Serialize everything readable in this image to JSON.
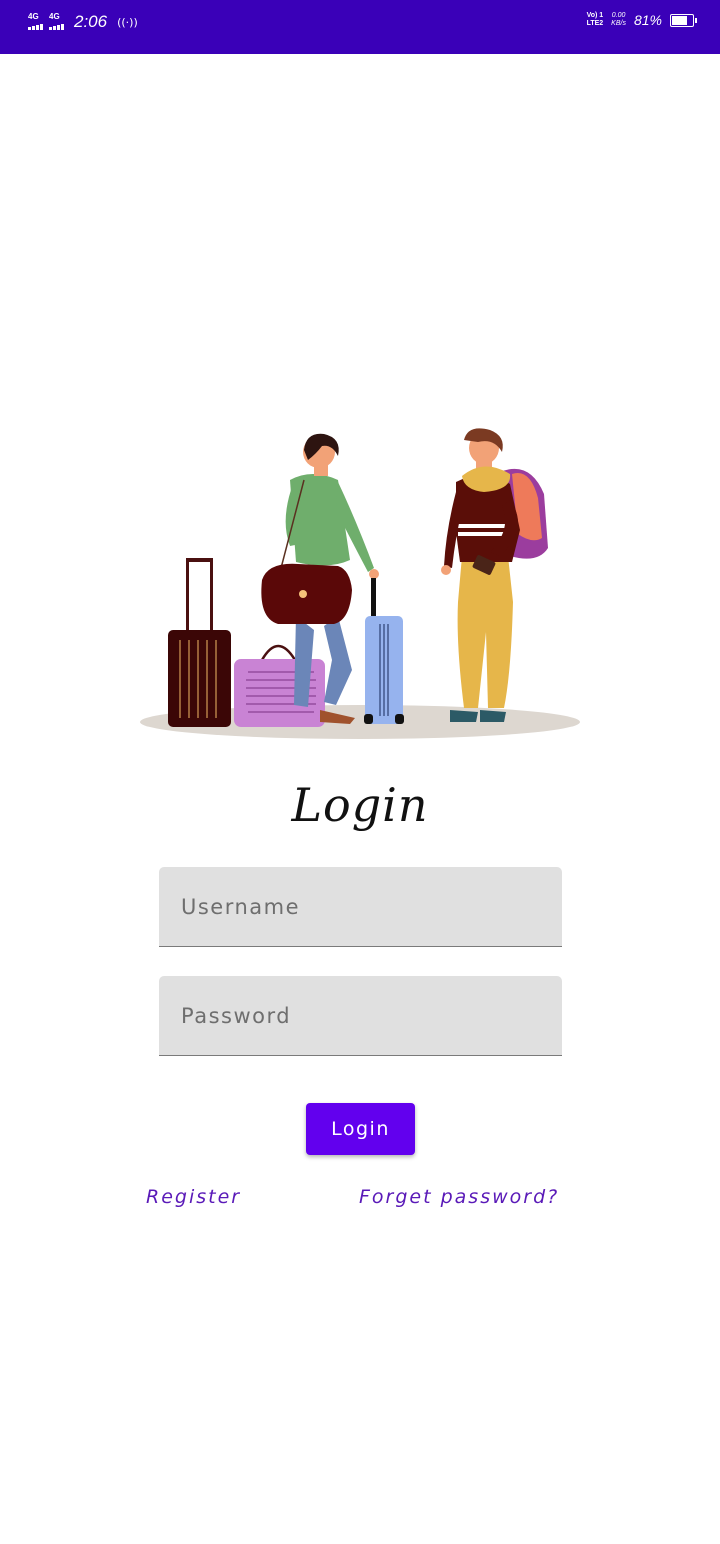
{
  "status_bar": {
    "network_1": "4G",
    "network_2": "4G",
    "time": "2:06",
    "volte_line1": "Vo) 1",
    "volte_line2": "LTE2",
    "speed_value": "0.00",
    "speed_unit": "KB/s",
    "battery_percent": "81%",
    "battery_level": 0.81,
    "colors": {
      "background": "#3a00b8"
    }
  },
  "login": {
    "title": "Login",
    "username_placeholder": "Username",
    "password_placeholder": "Password",
    "submit_label": "Login",
    "register_link": "Register",
    "forgot_link": "Forget password?",
    "colors": {
      "accent": "#6200ee",
      "link": "#5a1ab8",
      "field_bg": "#e0e0e0"
    }
  },
  "illustration": {
    "icon": "travelers-with-luggage-illustration"
  }
}
